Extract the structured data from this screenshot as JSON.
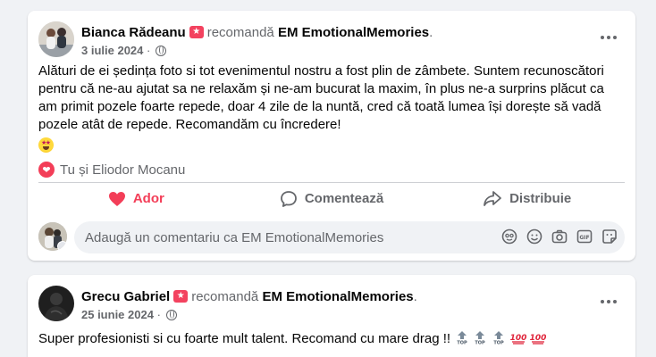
{
  "posts": [
    {
      "author": "Bianca Rădeanu",
      "recommends": "recomandă",
      "page": "EM EmotionalMemories",
      "page_suffix": ".",
      "date": "3 iulie 2024",
      "date_sep": "·",
      "text": "Alături de ei ședința foto si tot evenimentul nostru a fost plin de zâmbete. Suntem recunoscători pentru că ne-au ajutat sa ne relaxăm și ne-am bucurat la maxim, în plus ne-a surprins plăcut ca am primit pozele foarte repede, doar 4 zile de la nuntă, cred că toată lumea își dorește să vadă pozele atât de repede. Recomandăm cu încredere!",
      "reactions_text": "Tu și Eliodor Mocanu",
      "actions": {
        "like": "Ador",
        "comment": "Comentează",
        "share": "Distribuie"
      },
      "comment_placeholder": "Adaugă un comentariu ca EM EmotionalMemories"
    },
    {
      "author": "Grecu Gabriel",
      "recommends": "recomandă",
      "page": "EM EmotionalMemories",
      "page_suffix": ".",
      "date": "25 iunie 2024",
      "date_sep": "·",
      "text": "Super profesionisti si cu foarte mult talent. Recomand cu mare drag !!"
    }
  ],
  "colors": {
    "background": "#f0f2f5",
    "card": "#ffffff",
    "love": "#f33e58",
    "recommend_badge": "#f3425f",
    "secondary_text": "#65676b"
  },
  "icons": [
    "more-options-icon",
    "globe-icon",
    "heart-icon",
    "comment-icon",
    "share-icon",
    "avatar-sticker-icon",
    "emoji-icon",
    "camera-icon",
    "gif-icon",
    "sticker-icon",
    "top-emoji-icon",
    "hundred-points-emoji-icon",
    "star-struck-emoji-icon"
  ]
}
